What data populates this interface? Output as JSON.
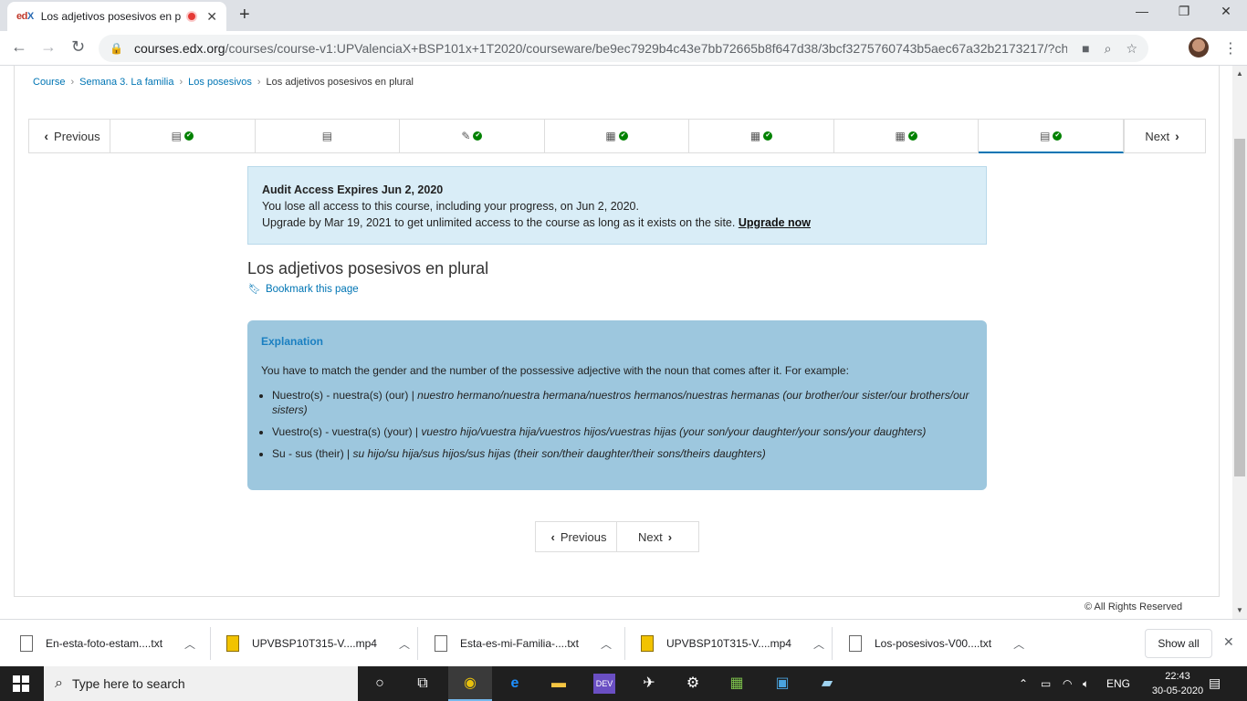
{
  "browser": {
    "tab_title": "Los adjetivos posesivos en p",
    "tab_favicon_text_a": "ed",
    "tab_favicon_text_b": "X",
    "url_host": "courses.edx.org",
    "url_rest": "/courses/course-v1:UPValenciaX+BSP101x+1T2020/courseware/be9ec7929b4c43e7bb72665b8f647d38/3bcf3275760743b5aec67a32b2173217/?child=fi..."
  },
  "breadcrumb": {
    "items": [
      "Course",
      "Semana 3. La familia",
      "Los posesivos"
    ],
    "current": "Los adjetivos posesivos en plural",
    "separator": "›"
  },
  "sequence_nav": {
    "previous_label": "Previous",
    "next_label": "Next"
  },
  "alert": {
    "title": "Audit Access Expires Jun 2, 2020",
    "line1": "You lose all access to this course, including your progress, on Jun 2, 2020.",
    "line2": "Upgrade by Mar 19, 2021 to get unlimited access to the course as long as it exists on the site.",
    "link": "Upgrade now"
  },
  "unit": {
    "title": "Los adjetivos posesivos en plural",
    "bookmark_label": "Bookmark this page"
  },
  "explanation": {
    "heading": "Explanation",
    "intro": "You have to match the gender and the number of the possessive adjective with the noun that comes after it. For example:",
    "items": [
      {
        "plain": "Nuestro(s) - nuestra(s) (our) | ",
        "italic": "nuestro hermano/nuestra hermana/nuestros hermanos/nuestras hermanas (our brother/our sister/our brothers/our sisters)"
      },
      {
        "plain": "Vuestro(s) - vuestra(s) (your) | ",
        "italic": "vuestro hijo/vuestra hija/vuestros hijos/vuestras hijas (your son/your daughter/your sons/your daughters)"
      },
      {
        "plain": "Su - sus (their) | ",
        "italic": "su hijo/su hija/sus hijos/sus hijas (their son/their daughter/their sons/theirs daughters)"
      }
    ]
  },
  "bottom_nav": {
    "previous_label": "Previous",
    "next_label": "Next"
  },
  "footer": {
    "copyright": "© All Rights Reserved"
  },
  "downloads": {
    "items": [
      "En-esta-foto-estam....txt",
      "UPVBSP10T315-V....mp4",
      "Esta-es-mi-Familia-....txt",
      "UPVBSP10T315-V....mp4",
      "Los-posesivos-V00....txt"
    ],
    "show_all": "Show all"
  },
  "taskbar": {
    "search_placeholder": "Type here to search",
    "lang": "ENG",
    "time": "22:43",
    "date": "30-05-2020"
  }
}
